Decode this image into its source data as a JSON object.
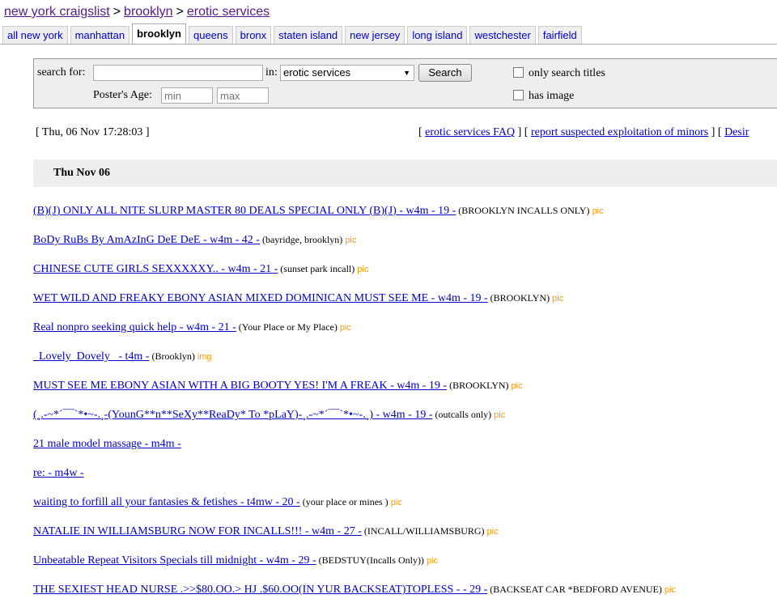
{
  "breadcrumb": {
    "site": "new york craigslist",
    "sep1": ">",
    "area": "brooklyn",
    "sep2": ">",
    "category": "erotic services"
  },
  "tabs": [
    {
      "label": "all new york",
      "active": false
    },
    {
      "label": "manhattan",
      "active": false
    },
    {
      "label": "brooklyn",
      "active": true
    },
    {
      "label": "queens",
      "active": false
    },
    {
      "label": "bronx",
      "active": false
    },
    {
      "label": "staten island",
      "active": false
    },
    {
      "label": "new jersey",
      "active": false
    },
    {
      "label": "long island",
      "active": false
    },
    {
      "label": "westchester",
      "active": false
    },
    {
      "label": "fairfield",
      "active": false
    }
  ],
  "search": {
    "search_for_label": "search for:",
    "query_value": "",
    "in_label": "in:",
    "category_selected": "erotic services",
    "button_label": "Search",
    "only_titles_label": "only search titles",
    "has_image_label": "has image",
    "poster_age_label": "Poster's Age:",
    "age_min_placeholder": "min",
    "age_max_placeholder": "max"
  },
  "timestamp": "[ Thu, 06 Nov 17:28:03 ]",
  "top_links": {
    "open1": "[",
    "faq": "erotic services FAQ",
    "mid": "] [",
    "report": "report suspected exploitation of minors",
    "mid2": "] [",
    "desire": "Desir"
  },
  "day_header": "Thu Nov 06",
  "listings": [
    {
      "title": "(B)(J) ONLY ALL NITE SLURP MASTER 80 DEALS SPECIAL ONLY (B)(J) - w4m - 19 -",
      "location": "(BROOKLYN INCALLS ONLY)",
      "tag": "pic"
    },
    {
      "title": "BoDy RuBs By AmAzInG DeE DeE - w4m - 42 -",
      "location": "(bayridge, brooklyn)",
      "tag": "pic"
    },
    {
      "title": "CHINESE CUTE GIRLS SEXXXXXY.. - w4m - 21 -",
      "location": "(sunset park incall)",
      "tag": "pic"
    },
    {
      "title": "WET WILD AND FREAKY EBONY ASIAN MIXED DOMINICAN MUST SEE ME - w4m - 19 -",
      "location": "(BROOKLYN)",
      "tag": "pic"
    },
    {
      "title": "Real nonpro seeking quick help - w4m - 21 -",
      "location": "(Your Place or My Place)",
      "tag": "pic"
    },
    {
      "title": "  Lovely  Dovely   - t4m -",
      "location": "(Brooklyn)",
      "tag": "img"
    },
    {
      "title": "MUST SEE ME EBONY ASIAN WITH A BIG BOOTY YES! I'M A FREAK - w4m - 19 -",
      "location": "(BROOKLYN)",
      "tag": "pic"
    },
    {
      "title": "(¸.-~*´¯¯`*•~-.¸-(YounG**n**SeXy**ReaDy* To *pLaY)-¸.-~*´¯¯`*•~-.¸) - w4m - 19 -",
      "location": "(outcalls only)",
      "tag": "pic"
    },
    {
      "title": "21 male model massage - m4m -",
      "location": "",
      "tag": ""
    },
    {
      "title": "re: - m4w -",
      "location": "",
      "tag": ""
    },
    {
      "title": "waiting to forfill all your fantasies & fetishes - t4mw - 20 -",
      "location": "(your place or mines )",
      "tag": "pic"
    },
    {
      "title": "NATALIE IN WILLIAMSBURG NOW FOR INCALLS!!! - w4m - 27 -",
      "location": "(INCALL/WILLIAMSBURG)",
      "tag": "pic"
    },
    {
      "title": "Unbeatable Repeat Visitors Specials till midnight - w4m - 29 -",
      "location": "(BEDSTUY(Incalls Only))",
      "tag": "pic"
    },
    {
      "title": "THE SEXIEST HEAD NURSE .>>$80.OO.> HJ .$60.OO(IN YUR BACKSEAT)TOPLESS - - 29 -",
      "location": "(BACKSEAT CAR *BEDFORD AVENUE)",
      "tag": "pic"
    }
  ]
}
